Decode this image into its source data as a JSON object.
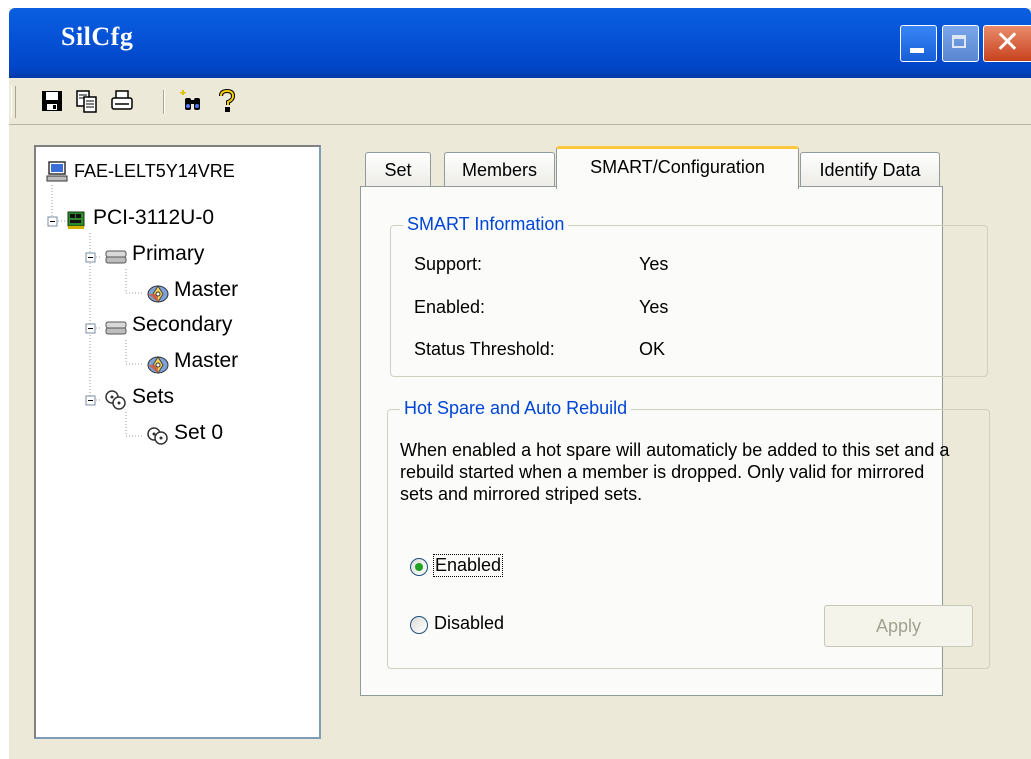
{
  "window": {
    "title": "SilCfg",
    "controls": [
      "minimize-icon",
      "maximize-icon",
      "close-icon"
    ]
  },
  "toolbar": {
    "items": [
      "save-icon",
      "copy-icon",
      "print-icon",
      "find-icon",
      "help-icon"
    ]
  },
  "tree": {
    "root": "FAE-LELT5Y14VRE",
    "controller": "PCI-3112U-0",
    "primary": "Primary",
    "primary_master": "Master",
    "secondary": "Secondary",
    "secondary_master": "Master",
    "sets": "Sets",
    "set0": "Set 0"
  },
  "tabs": [
    {
      "label": "Set"
    },
    {
      "label": "Members"
    },
    {
      "label": "SMART/Configuration",
      "active": true
    },
    {
      "label": "Identify Data"
    }
  ],
  "smart": {
    "legend": "SMART Information",
    "rows": [
      {
        "label": "Support:",
        "value": "Yes"
      },
      {
        "label": "Enabled:",
        "value": "Yes"
      },
      {
        "label": "Status Threshold:",
        "value": "OK"
      }
    ]
  },
  "hotspare": {
    "legend": "Hot Spare and Auto Rebuild",
    "description": "When enabled a hot spare will automaticly be added to this set and a rebuild started when a member is dropped. Only valid for mirrored sets and mirrored striped sets.",
    "enabled_label": "Enabled",
    "disabled_label": "Disabled",
    "selected": "Enabled",
    "apply_label": "Apply"
  },
  "colors": {
    "titlebar": "#0553d6",
    "legend_text": "#0046d5",
    "active_tab_accent": "#ffc83c",
    "window_bg": "#ece9d8"
  }
}
